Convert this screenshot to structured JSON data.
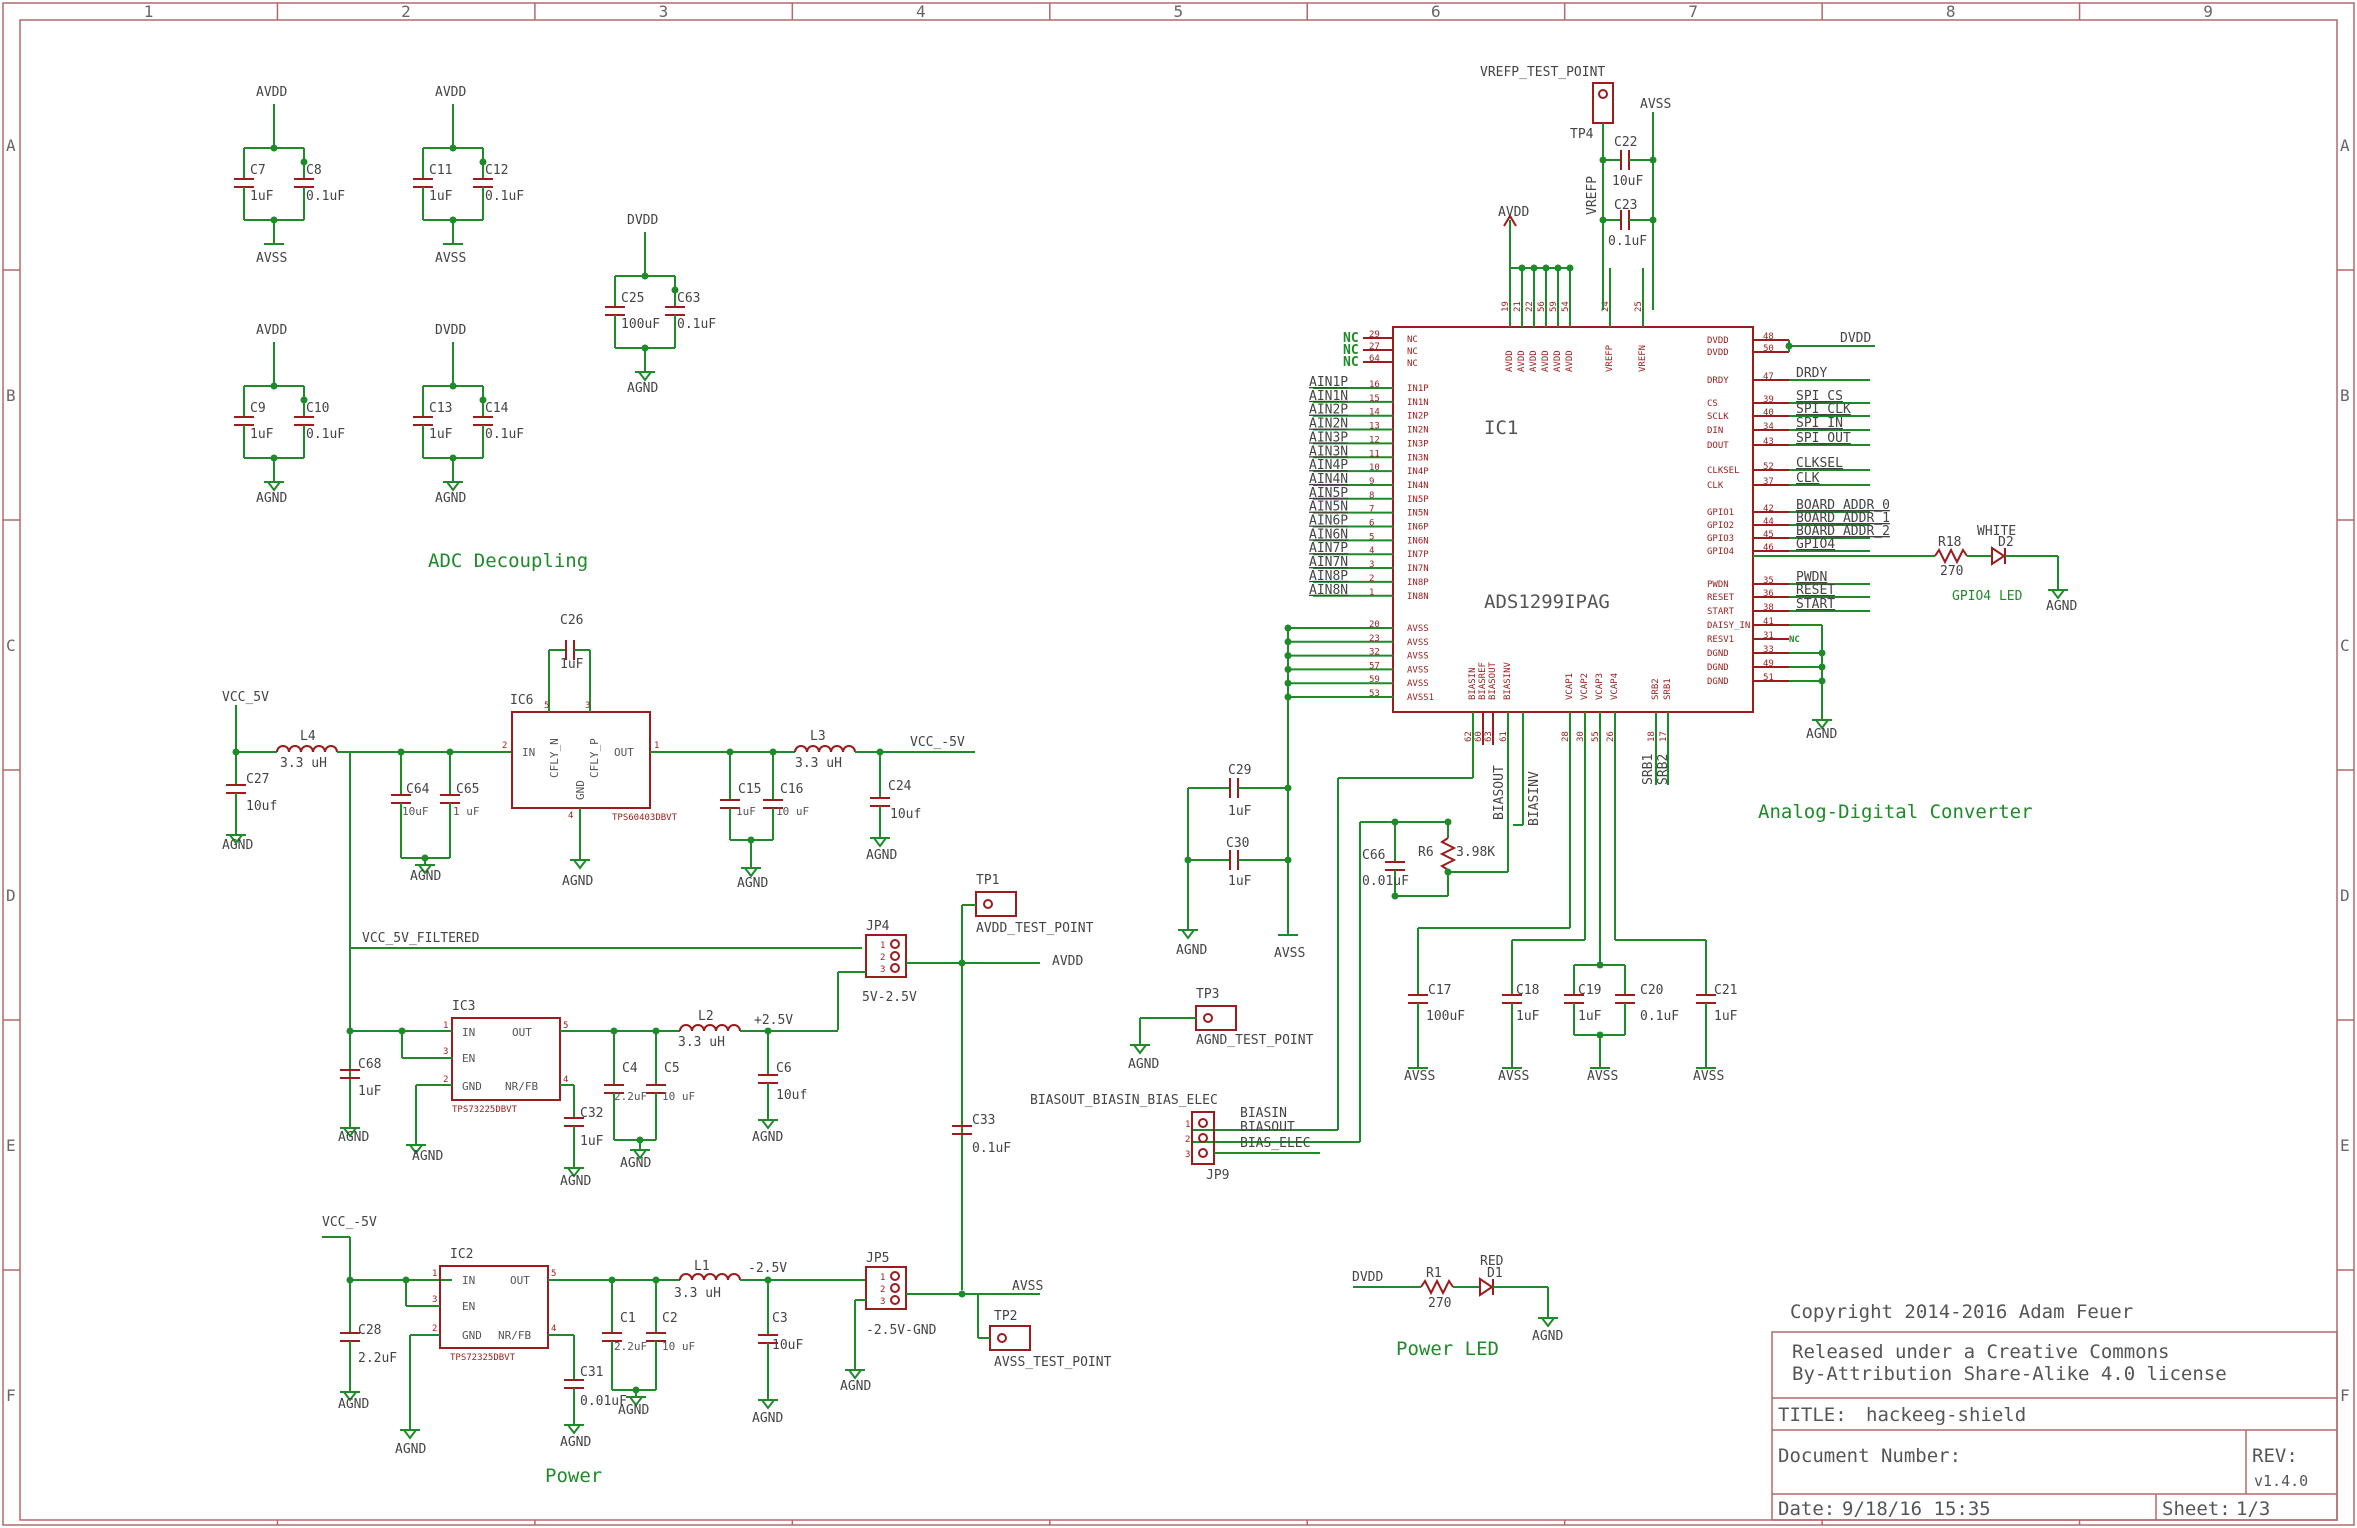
{
  "frame": {
    "cols": [
      "1",
      "2",
      "3",
      "4",
      "5",
      "6",
      "7",
      "8",
      "9"
    ],
    "rows": [
      "A",
      "B",
      "C",
      "D",
      "E",
      "F"
    ]
  },
  "colors": {
    "wire": "#1f8a2a",
    "component": "#9b1c1c",
    "text": "#555555",
    "border": "#a05050",
    "greenText": "#2a9a2a"
  },
  "sections": {
    "adc_decoupling": "ADC Decoupling",
    "power": "Power",
    "adc": "Analog-Digital Converter",
    "power_led": "Power LED",
    "gpio4_led": "GPIO4 LED"
  },
  "decoupling": [
    {
      "rail": "AVDD",
      "ref": "AVSS",
      "c1": "C7",
      "v1": "1uF",
      "c2": "C8",
      "v2": "0.1uF"
    },
    {
      "rail": "AVDD",
      "ref": "AVSS",
      "c1": "C11",
      "v1": "1uF",
      "c2": "C12",
      "v2": "0.1uF"
    },
    {
      "rail": "AVDD",
      "ref": "AGND",
      "c1": "C9",
      "v1": "1uF",
      "c2": "C10",
      "v2": "0.1uF"
    },
    {
      "rail": "DVDD",
      "ref": "AGND",
      "c1": "C13",
      "v1": "1uF",
      "c2": "C14",
      "v2": "0.1uF"
    },
    {
      "rail": "DVDD",
      "ref": "AGND",
      "c1": "C25",
      "v1": "100uF",
      "c2": "C63",
      "v2": "0.1uF"
    }
  ],
  "ic1": {
    "ref": "IC1",
    "part": "ADS1299IPAG",
    "nc": [
      "NC",
      "NC",
      "NC"
    ],
    "nc_pins": [
      "29",
      "27",
      "64"
    ],
    "nc_names": [
      "NC",
      "NC",
      "NC"
    ],
    "inputs": [
      "AIN1P",
      "AIN1N",
      "AIN2P",
      "AIN2N",
      "AIN3P",
      "AIN3N",
      "AIN4P",
      "AIN4N",
      "AIN5P",
      "AIN5N",
      "AIN6P",
      "AIN6N",
      "AIN7P",
      "AIN7N",
      "AIN8P",
      "AIN8N"
    ],
    "input_pins": [
      "16",
      "15",
      "14",
      "13",
      "12",
      "11",
      "10",
      "9",
      "8",
      "7",
      "6",
      "5",
      "4",
      "3",
      "2",
      "1"
    ],
    "input_names": [
      "IN1P",
      "IN1N",
      "IN2P",
      "IN2N",
      "IN3P",
      "IN3N",
      "IN4P",
      "IN4N",
      "IN5P",
      "IN5N",
      "IN6P",
      "IN6N",
      "IN7P",
      "IN7N",
      "IN8P",
      "IN8N"
    ],
    "avss_pins": [
      "20",
      "23",
      "32",
      "57",
      "59",
      "53"
    ],
    "avss_names": [
      "AVSS",
      "AVSS",
      "AVSS",
      "AVSS",
      "AVSS",
      "AVSS1"
    ],
    "top_pins": [
      "19",
      "21",
      "22",
      "56",
      "59",
      "54",
      "24",
      "25"
    ],
    "top_names": [
      "AVDD",
      "AVDD",
      "AVDD",
      "AVDD",
      "AVDD",
      "AVDD",
      "VREFP",
      "VREFN"
    ],
    "bottom_pins": [
      "62",
      "60",
      "63",
      "61",
      "28",
      "30",
      "55",
      "26",
      "18",
      "17"
    ],
    "bottom_names": [
      "BIASIN",
      "BIASREF",
      "BIASOUT",
      "BIASINV",
      "VCAP1",
      "VCAP2",
      "VCAP3",
      "VCAP4",
      "SRB2",
      "SRB1"
    ],
    "right_pins": [
      "48",
      "50",
      "47",
      "39",
      "40",
      "34",
      "43",
      "52",
      "37",
      "42",
      "44",
      "45",
      "46",
      "35",
      "36",
      "38",
      "41",
      "31",
      "33",
      "49",
      "51"
    ],
    "right_names": [
      "DVDD",
      "DVDD",
      "DRDY",
      "CS",
      "SCLK",
      "DIN",
      "DOUT",
      "CLKSEL",
      "CLK",
      "GPIO1",
      "GPIO2",
      "GPIO3",
      "GPIO4",
      "PWDN",
      "RESET",
      "START",
      "DAISY_IN",
      "RESV1",
      "DGND",
      "DGND",
      "DGND"
    ],
    "right_nets": [
      "DVDD",
      "DRDY",
      "SPI_CS",
      "SPI_CLK",
      "SPI_IN",
      "SPI_OUT",
      "CLKSEL",
      "CLK",
      "BOARD_ADDR_0",
      "BOARD_ADDR_1",
      "BOARD_ADDR_2",
      "GPIO4",
      "PWDN",
      "RESET",
      "START"
    ],
    "resv_nc": "NC",
    "dgnd": "AGND",
    "avdd": "AVDD",
    "vrefp": "VREFP",
    "tp4": "VREFP_TEST_POINT",
    "tp4_ref": "TP4",
    "avss_label": "AVSS",
    "c22": "C22",
    "c22v": "10uF",
    "c23": "C23",
    "c23v": "0.1uF",
    "biasout": "BIASOUT",
    "biasinv": "BIASINV",
    "srb1": "SRB1",
    "srb2": "SRB2"
  },
  "adc_bottom": {
    "c29": "C29",
    "c29v": "1uF",
    "c30": "C30",
    "c30v": "1uF",
    "agnd": "AGND",
    "avss": "AVSS",
    "c66": "C66",
    "c66v": "0.01uF",
    "r6": "R6",
    "r6v": "3.98K",
    "c17": "C17",
    "c17v": "100uF",
    "c18": "C18",
    "c18v": "1uF",
    "c19": "C19",
    "c19v": "1uF",
    "c20": "C20",
    "c20v": "0.1uF",
    "c21": "C21",
    "c21v": "1uF"
  },
  "gpio_led": {
    "r": "R18",
    "rv": "270",
    "d": "D2",
    "dv": "WHITE",
    "gnd": "AGND"
  },
  "power_led": {
    "net": "DVDD",
    "r": "R1",
    "rv": "270",
    "d": "D1",
    "dv": "RED",
    "gnd": "AGND"
  },
  "tp": {
    "tp3": "TP3",
    "tp3n": "AGND_TEST_POINT",
    "agnd": "AGND",
    "tp1": "TP1",
    "tp1n": "AVDD_TEST_POINT",
    "tp2": "TP2",
    "tp2n": "AVSS_TEST_POINT"
  },
  "jp9": {
    "title": "BIASOUT_BIASIN_BIAS_ELEC",
    "ref": "JP9",
    "pins": [
      "BIASIN",
      "BIASOUT",
      "BIAS_ELEC"
    ],
    "nums": [
      "1",
      "2",
      "3"
    ]
  },
  "power": {
    "vcc5": "VCC_5V",
    "l4": "L4",
    "l4v": "3.3 uH",
    "c27": "C27",
    "c27v": "10uf",
    "agnd": "AGND",
    "c64": "C64",
    "c64v": "10uF",
    "c65": "C65",
    "c65v": "1 uF",
    "c26": "C26",
    "c26v": "1uF",
    "ic6": "IC6",
    "ic6p": "TPS60403DBVT",
    "ic6pins": [
      "IN",
      "CFLY_N",
      "CFLY_P",
      "OUT",
      "GND"
    ],
    "ic6nums": [
      "2",
      "5",
      "3",
      "1",
      "4"
    ],
    "c15": "C15",
    "c15v": "1uF",
    "c16": "C16",
    "c16v": "10 uF",
    "l3": "L3",
    "l3v": "3.3 uH",
    "vccm5": "VCC_-5V",
    "c24": "C24",
    "c24v": "10uf",
    "vcc5f": "VCC_5V_FILTERED",
    "jp4": "JP4",
    "jp4v": "5V-2.5V",
    "avdd": "AVDD",
    "jp_nums": [
      "1",
      "2",
      "3"
    ],
    "ic3": "IC3",
    "ic3p": "TPS73225DBVT",
    "ldo_pins": [
      "IN",
      "EN",
      "GND",
      "OUT",
      "NR/FB"
    ],
    "ic3nums": [
      "1",
      "3",
      "2",
      "5",
      "4"
    ],
    "c68": "C68",
    "c68v": "1uF",
    "c32": "C32",
    "c32v": "1uF",
    "c4": "C4",
    "c4v": "2.2uF",
    "c5": "C5",
    "c5v": "10 uF",
    "l2": "L2",
    "l2v": "3.3 uH",
    "p25": "+2.5V",
    "c6": "C6",
    "c6v": "10uf",
    "c33": "C33",
    "c33v": "0.1uF",
    "vccm5b": "VCC_-5V",
    "ic2": "IC2",
    "ic2p": "TPS72325DBVT",
    "ic2nums": [
      "1",
      "3",
      "2",
      "5",
      "4"
    ],
    "c28": "C28",
    "c28v": "2.2uF",
    "c31": "C31",
    "c31v": "0.01uF",
    "c1": "C1",
    "c1v": "2.2uF",
    "c2": "C2",
    "c2v": "10 uF",
    "l1": "L1",
    "l1v": "3.3 uH",
    "m25": "-2.5V",
    "c3": "C3",
    "c3v": "10uF",
    "jp5": "JP5",
    "jp5v": "-2.5V-GND",
    "avss": "AVSS"
  },
  "titleblock": {
    "copyright": "Copyright 2014-2016 Adam Feuer",
    "license1": "Released under a Creative Commons",
    "license2": "By-Attribution Share-Alike 4.0 license",
    "title_label": "TITLE:",
    "title": "hackeeg-shield",
    "docnum": "Document Number:",
    "rev_label": "REV:",
    "rev": "v1.4.0",
    "date_label": "Date:",
    "date": "9/18/16 15:35",
    "sheet_label": "Sheet:",
    "sheet": "1/3"
  }
}
